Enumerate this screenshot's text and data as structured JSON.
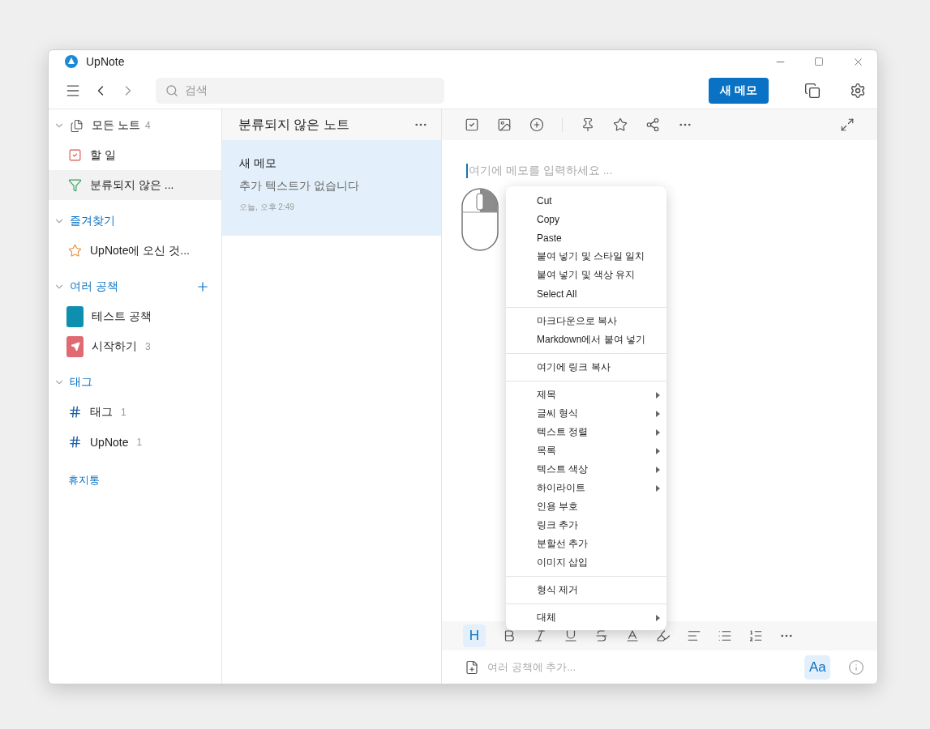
{
  "window": {
    "title": "UpNote"
  },
  "toolbar": {
    "search_placeholder": "검색",
    "new_button": "새 메모"
  },
  "sidebar": [
    {
      "kind": "section",
      "label": "모든 노트",
      "count": "4",
      "expanded": true,
      "icon": true,
      "children": [
        {
          "kind": "todo",
          "label": "할 일",
          "selected": false
        },
        {
          "kind": "filter",
          "label": "분류되지 않은 ...",
          "selected": true
        }
      ]
    },
    {
      "kind": "section",
      "label": "즐겨찾기",
      "expanded": true,
      "children": [
        {
          "kind": "favorite",
          "label": "UpNote에 오신 것...",
          "selected": false
        }
      ]
    },
    {
      "kind": "section",
      "label": "여러 공책",
      "expanded": true,
      "add": true,
      "children": [
        {
          "kind": "notebook",
          "label": "테스트 공책",
          "color": "#0e8fb0",
          "selected": false
        },
        {
          "kind": "notebook",
          "label": "시작하기",
          "count": "3",
          "color": "#e06a72",
          "selected": false
        }
      ]
    },
    {
      "kind": "section",
      "label": "태그",
      "expanded": true,
      "children": [
        {
          "kind": "tag",
          "label": "태그",
          "count": "1",
          "selected": false
        },
        {
          "kind": "tag",
          "label": "UpNote",
          "count": "1",
          "selected": false
        }
      ]
    },
    {
      "kind": "link",
      "label": "휴지통"
    }
  ],
  "note_list": {
    "title": "분류되지 않은 노트",
    "notes": [
      {
        "title": "새 메모",
        "preview": "추가 텍스트가 없습니다",
        "time": "오늘, 오후 2:49",
        "selected": true
      }
    ]
  },
  "editor": {
    "placeholder": "여기에 메모를 입력하세요 ...",
    "heading_button": {
      "label": "H",
      "selected": true
    },
    "font_button": "Aa",
    "notebook_placeholder": "여러 공책에 추가..."
  },
  "context_menu": [
    [
      {
        "label": "Cut"
      },
      {
        "label": "Copy"
      },
      {
        "label": "Paste"
      },
      {
        "label": "붙여 넣기 및 스타일 일치"
      },
      {
        "label": "붙여 넣기 및 색상 유지"
      },
      {
        "label": "Select All"
      }
    ],
    [
      {
        "label": "마크다운으로 복사"
      },
      {
        "label": "Markdown에서 붙여 넣기"
      }
    ],
    [
      {
        "label": "여기에 링크 복사"
      }
    ],
    [
      {
        "label": "제목",
        "submenu": true
      },
      {
        "label": "글씨 형식",
        "submenu": true
      },
      {
        "label": "텍스트 정렬",
        "submenu": true
      },
      {
        "label": "목록",
        "submenu": true
      },
      {
        "label": "텍스트 색상",
        "submenu": true
      },
      {
        "label": "하이라이트",
        "submenu": true
      },
      {
        "label": "인용 부호",
        "submenu": false
      },
      {
        "label": "링크 추가",
        "submenu": false
      },
      {
        "label": "분할선 추가",
        "submenu": false
      },
      {
        "label": "이미지 삽입",
        "submenu": false
      }
    ],
    [
      {
        "label": "형식 제거",
        "submenu": false
      }
    ],
    [
      {
        "label": "대체",
        "submenu": true
      }
    ]
  ]
}
